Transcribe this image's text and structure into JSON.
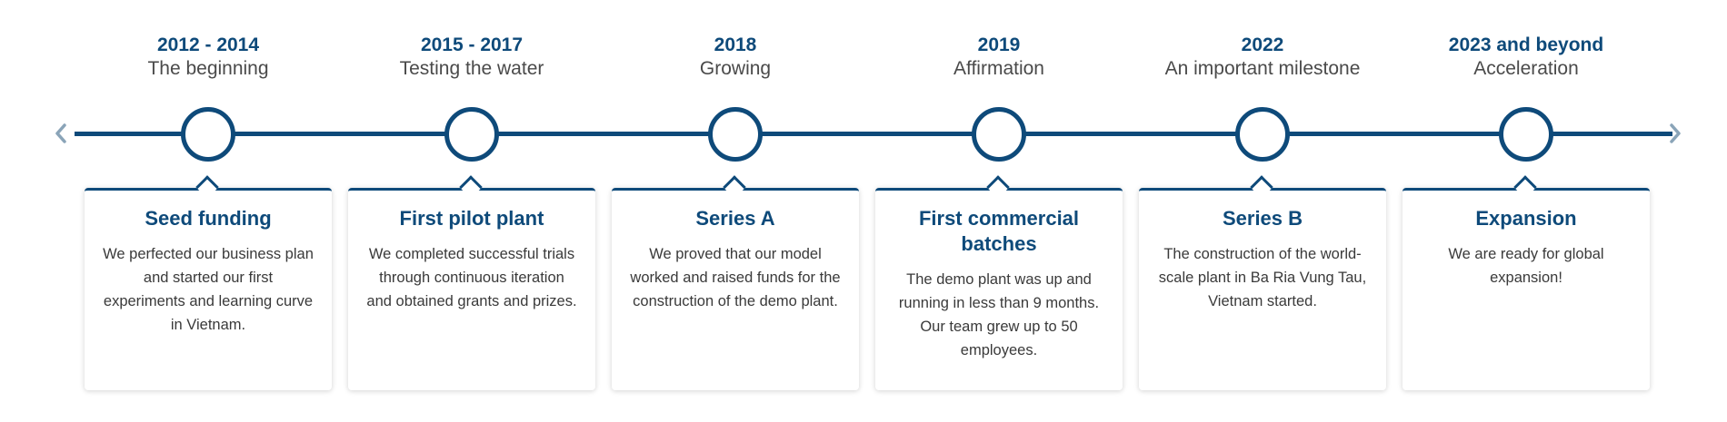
{
  "colors": {
    "accent": "#0e4a7a",
    "nav_arrow": "#8aa4b8",
    "text": "#3a3a3a",
    "subtitle": "#4a4a4a",
    "card_bg": "#ffffff"
  },
  "nav": {
    "prev_icon": "chevron-left-icon",
    "next_icon": "chevron-right-icon"
  },
  "milestones": [
    {
      "period": "2012 - 2014",
      "phase": "The beginning",
      "title": "Seed funding",
      "text": "We perfected our business plan and started our first experiments and learning curve in Vietnam."
    },
    {
      "period": "2015 - 2017",
      "phase": "Testing the water",
      "title": "First pilot plant",
      "text": "We completed successful trials through continuous iteration and obtained grants and prizes."
    },
    {
      "period": "2018",
      "phase": "Growing",
      "title": "Series A",
      "text": "We proved that our model worked and raised funds for the construction of the demo plant."
    },
    {
      "period": "2019",
      "phase": "Affirmation",
      "title": "First commercial batches",
      "text": "The demo plant was up and running in less than 9 months. Our team grew up to 50 employees."
    },
    {
      "period": "2022",
      "phase": "An important milestone",
      "title": "Series B",
      "text": "The construction of the world-scale plant in Ba Ria Vung Tau, Vietnam started."
    },
    {
      "period": "2023 and beyond",
      "phase": "Acceleration",
      "title": "Expansion",
      "text": "We are ready for global expansion!"
    }
  ]
}
